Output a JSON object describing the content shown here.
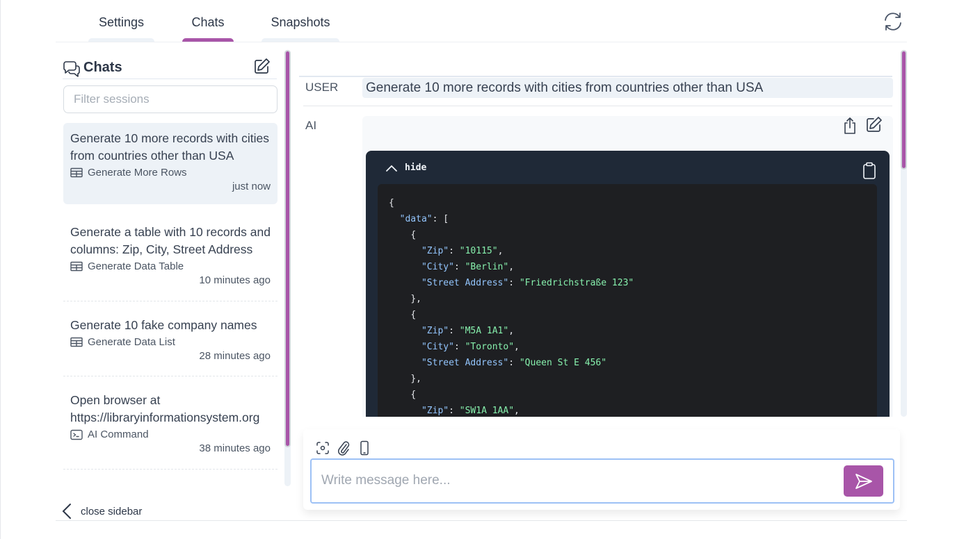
{
  "tabs": [
    {
      "label": "Settings",
      "active": false
    },
    {
      "label": "Chats",
      "active": true
    },
    {
      "label": "Snapshots",
      "active": false
    }
  ],
  "header": {
    "refresh_icon": "refresh-icon"
  },
  "colors": {
    "accent": "#a855a8",
    "code_bg": "#1f2937",
    "input_border": "#9dc1f5"
  },
  "sidebar": {
    "title": "Chats",
    "filter_placeholder": "Filter sessions",
    "filter_value": "",
    "close_label": "close sidebar",
    "items": [
      {
        "title": "Generate 10 more records with cities from countries other than USA",
        "kind": "Generate More Rows",
        "kind_icon": "table-icon",
        "time": "just now",
        "selected": true
      },
      {
        "title": "Generate a table with 10 records and columns: Zip, City, Street Address",
        "kind": "Generate Data Table",
        "kind_icon": "table-icon",
        "time": "10 minutes ago",
        "selected": false
      },
      {
        "title": "Generate 10 fake company names",
        "kind": "Generate Data List",
        "kind_icon": "table-icon",
        "time": "28 minutes ago",
        "selected": false
      },
      {
        "title": "Open browser at https://libraryinformationsystem.org",
        "kind": "AI Command",
        "kind_icon": "terminal-icon",
        "time": "38 minutes ago",
        "selected": false
      }
    ]
  },
  "conversation": {
    "user_label": "USER",
    "user_message": "Generate 10 more records with cities from countries other than USA",
    "ai_label": "AI",
    "code_toggle_label": "hide",
    "code_lines": [
      {
        "indent": 0,
        "parts": [
          {
            "t": "p",
            "v": "{"
          }
        ]
      },
      {
        "indent": 1,
        "parts": [
          {
            "t": "k",
            "v": "\"data\""
          },
          {
            "t": "p",
            "v": ": ["
          }
        ]
      },
      {
        "indent": 2,
        "parts": [
          {
            "t": "p",
            "v": "{"
          }
        ]
      },
      {
        "indent": 3,
        "parts": [
          {
            "t": "k",
            "v": "\"Zip\""
          },
          {
            "t": "p",
            "v": ": "
          },
          {
            "t": "s",
            "v": "\"10115\""
          },
          {
            "t": "p",
            "v": ","
          }
        ]
      },
      {
        "indent": 3,
        "parts": [
          {
            "t": "k",
            "v": "\"City\""
          },
          {
            "t": "p",
            "v": ": "
          },
          {
            "t": "s",
            "v": "\"Berlin\""
          },
          {
            "t": "p",
            "v": ","
          }
        ]
      },
      {
        "indent": 3,
        "parts": [
          {
            "t": "k",
            "v": "\"Street Address\""
          },
          {
            "t": "p",
            "v": ": "
          },
          {
            "t": "s",
            "v": "\"Friedrichstraße 123\""
          }
        ]
      },
      {
        "indent": 2,
        "parts": [
          {
            "t": "p",
            "v": "},"
          }
        ]
      },
      {
        "indent": 2,
        "parts": [
          {
            "t": "p",
            "v": "{"
          }
        ]
      },
      {
        "indent": 3,
        "parts": [
          {
            "t": "k",
            "v": "\"Zip\""
          },
          {
            "t": "p",
            "v": ": "
          },
          {
            "t": "s",
            "v": "\"M5A 1A1\""
          },
          {
            "t": "p",
            "v": ","
          }
        ]
      },
      {
        "indent": 3,
        "parts": [
          {
            "t": "k",
            "v": "\"City\""
          },
          {
            "t": "p",
            "v": ": "
          },
          {
            "t": "s",
            "v": "\"Toronto\""
          },
          {
            "t": "p",
            "v": ","
          }
        ]
      },
      {
        "indent": 3,
        "parts": [
          {
            "t": "k",
            "v": "\"Street Address\""
          },
          {
            "t": "p",
            "v": ": "
          },
          {
            "t": "s",
            "v": "\"Queen St E 456\""
          }
        ]
      },
      {
        "indent": 2,
        "parts": [
          {
            "t": "p",
            "v": "},"
          }
        ]
      },
      {
        "indent": 2,
        "parts": [
          {
            "t": "p",
            "v": "{"
          }
        ]
      },
      {
        "indent": 3,
        "parts": [
          {
            "t": "k",
            "v": "\"Zip\""
          },
          {
            "t": "p",
            "v": ": "
          },
          {
            "t": "s",
            "v": "\"SW1A 1AA\""
          },
          {
            "t": "p",
            "v": ","
          }
        ]
      }
    ]
  },
  "composer": {
    "placeholder": "Write message here...",
    "value": "",
    "tools": [
      "screenshot-icon",
      "paperclip-icon",
      "mobile-icon"
    ]
  }
}
